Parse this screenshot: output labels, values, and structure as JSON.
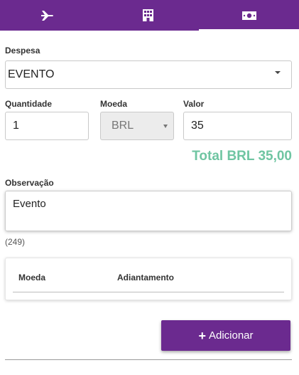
{
  "tabs": [
    {
      "id": "flight",
      "icon": "airplane-icon"
    },
    {
      "id": "hotel",
      "icon": "building-icon"
    },
    {
      "id": "money",
      "icon": "money-icon",
      "active": true
    }
  ],
  "colors": {
    "primary": "#6b2a8f",
    "total": "#6fc5a2"
  },
  "form": {
    "despesa_label": "Despesa",
    "despesa_value": "EVENTO",
    "quantidade_label": "Quantidade",
    "quantidade_value": "1",
    "moeda_label": "Moeda",
    "moeda_value": "BRL",
    "valor_label": "Valor",
    "valor_value": "35",
    "total_text": "Total BRL 35,00",
    "observacao_label": "Observação",
    "observacao_value": "Evento",
    "counter": "(249)"
  },
  "adiantamento_table": {
    "columns": [
      "Moeda",
      "Adiantamento"
    ]
  },
  "actions": {
    "add_label": "Adicionar"
  }
}
